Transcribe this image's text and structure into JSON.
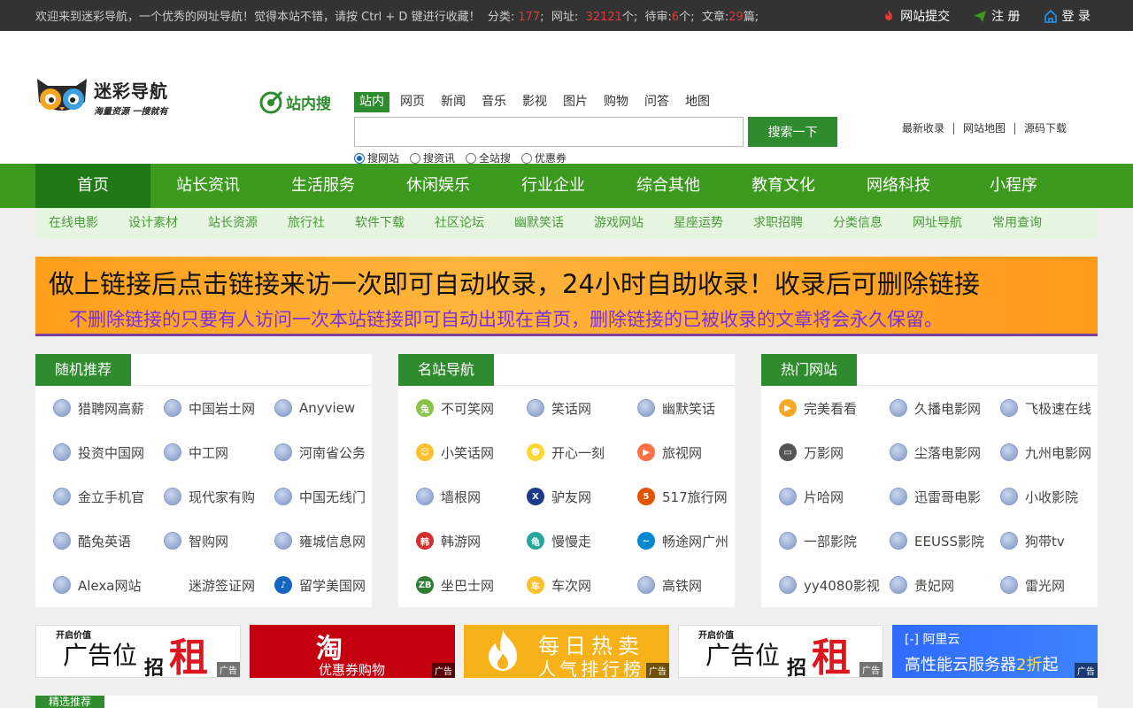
{
  "topbar": {
    "welcome": "欢迎来到迷彩导航，一个优秀的网址导航！觉得本站不错，请按 Ctrl + D 键进行收藏！",
    "cat_label": "分类:",
    "cat_count": "177",
    "url_label": "网址:",
    "url_count": "32121",
    "url_unit": "个;",
    "pending_label": "待审:",
    "pending_count": "6",
    "pending_unit": "个;",
    "article_label": "文章:",
    "article_count": "29",
    "article_unit": "篇;",
    "submit": "网站提交",
    "register": "注 册",
    "login": "登 录"
  },
  "logo": {
    "brand": "迷彩导航",
    "slogan": "海量资源 一搜就有"
  },
  "search": {
    "badge": "站内搜",
    "tabs": [
      "站内",
      "网页",
      "新闻",
      "音乐",
      "影视",
      "图片",
      "购物",
      "问答",
      "地图"
    ],
    "placeholder": "",
    "button": "搜索一下",
    "radios": [
      "搜网站",
      "搜资讯",
      "全站搜",
      "优惠券"
    ]
  },
  "header_links": [
    "最新收录",
    "网站地图",
    "源码下载"
  ],
  "nav": [
    "首页",
    "站长资讯",
    "生活服务",
    "休闲娱乐",
    "行业企业",
    "综合其他",
    "教育文化",
    "网络科技",
    "小程序"
  ],
  "subnav": [
    "在线电影",
    "设计素材",
    "站长资源",
    "旅行社",
    "软件下载",
    "社区论坛",
    "幽默笑话",
    "游戏网站",
    "星座运势",
    "求职招聘",
    "分类信息",
    "网址导航",
    "常用查询"
  ],
  "banner": {
    "line1": "做上链接后点击链接来访一次即可自动收录，24小时自助收录！收录后可删除链接",
    "line2": "不删除链接的只要有人访问一次本站链接即可自动出现在首页，删除链接的已被收录的文章将会永久保留。"
  },
  "panels": [
    {
      "title": "随机推荐",
      "items": [
        {
          "label": "猎聘网高薪",
          "icon": "globe-icon"
        },
        {
          "label": "中国岩土网",
          "icon": "globe-icon"
        },
        {
          "label": "Anyview",
          "icon": "globe-icon"
        },
        {
          "label": "投资中国网",
          "icon": "globe-icon"
        },
        {
          "label": "中工网",
          "icon": "globe-icon"
        },
        {
          "label": "河南省公务",
          "icon": "globe-icon"
        },
        {
          "label": "金立手机官",
          "icon": "globe-icon"
        },
        {
          "label": "现代家有购",
          "icon": "globe-icon"
        },
        {
          "label": "中国无线门",
          "icon": "globe-icon"
        },
        {
          "label": "酷兔英语",
          "icon": "globe-icon"
        },
        {
          "label": "智购网",
          "icon": "globe-icon"
        },
        {
          "label": "雍城信息网",
          "icon": "globe-icon"
        },
        {
          "label": "Alexa网站",
          "icon": "globe-icon"
        },
        {
          "label": "迷游签证网",
          "icon": "blank-icon"
        },
        {
          "label": "留学美国网",
          "icon": "note-icon"
        }
      ]
    },
    {
      "title": "名站导航",
      "items": [
        {
          "label": "不可笑网",
          "icon": "rabbit-icon"
        },
        {
          "label": "笑话网",
          "icon": "globe-icon"
        },
        {
          "label": "幽默笑话",
          "icon": "globe-icon"
        },
        {
          "label": "小笑话网",
          "icon": "smile-icon"
        },
        {
          "label": "开心一刻",
          "icon": "laugh-icon"
        },
        {
          "label": "旅视网",
          "icon": "play-icon"
        },
        {
          "label": "墙根网",
          "icon": "globe-icon"
        },
        {
          "label": "驴友网",
          "icon": "x-icon"
        },
        {
          "label": "517旅行网",
          "icon": "517-icon"
        },
        {
          "label": "韩游网",
          "icon": "hanyou-icon"
        },
        {
          "label": "慢慢走",
          "icon": "turtle-icon"
        },
        {
          "label": "畅途网广州",
          "icon": "changtu-icon"
        },
        {
          "label": "坐巴士网",
          "icon": "zb-icon"
        },
        {
          "label": "车次网",
          "icon": "bus-icon"
        },
        {
          "label": "高铁网",
          "icon": "globe-icon"
        }
      ]
    },
    {
      "title": "热门网站",
      "items": [
        {
          "label": "完美看看",
          "icon": "play-yellow-icon"
        },
        {
          "label": "久播电影网",
          "icon": "globe-icon"
        },
        {
          "label": "飞极速在线",
          "icon": "globe-icon"
        },
        {
          "label": "万影网",
          "icon": "tv-icon"
        },
        {
          "label": "尘落电影网",
          "icon": "globe-icon"
        },
        {
          "label": "九州电影网",
          "icon": "globe-icon"
        },
        {
          "label": "片哈网",
          "icon": "globe-icon"
        },
        {
          "label": "迅雷哥电影",
          "icon": "globe-icon"
        },
        {
          "label": "小收影院",
          "icon": "globe-icon"
        },
        {
          "label": "一部影院",
          "icon": "globe-icon"
        },
        {
          "label": "EEUSS影院",
          "icon": "globe-icon"
        },
        {
          "label": "狗带tv",
          "icon": "globe-icon"
        },
        {
          "label": "yy4080影视",
          "icon": "globe-icon"
        },
        {
          "label": "贵妃网",
          "icon": "globe-icon"
        },
        {
          "label": "雷光网",
          "icon": "globe-icon"
        }
      ]
    }
  ],
  "ads": {
    "tag": "广告",
    "rent_small": "开启价值",
    "rent_big": "广告位",
    "rent_zhao": "招",
    "rent_zu": "租",
    "taobao_t1": "淘",
    "taobao_t2": "优惠券购物",
    "hot_t1": "每日热卖",
    "hot_t2": "人气排行榜",
    "ali_t1": "阿里云",
    "ali_t2a": "高性能云服务器",
    "ali_t2b": "2折",
    "ali_t2c": "起"
  },
  "bottom_panel_title": "精选推荐"
}
